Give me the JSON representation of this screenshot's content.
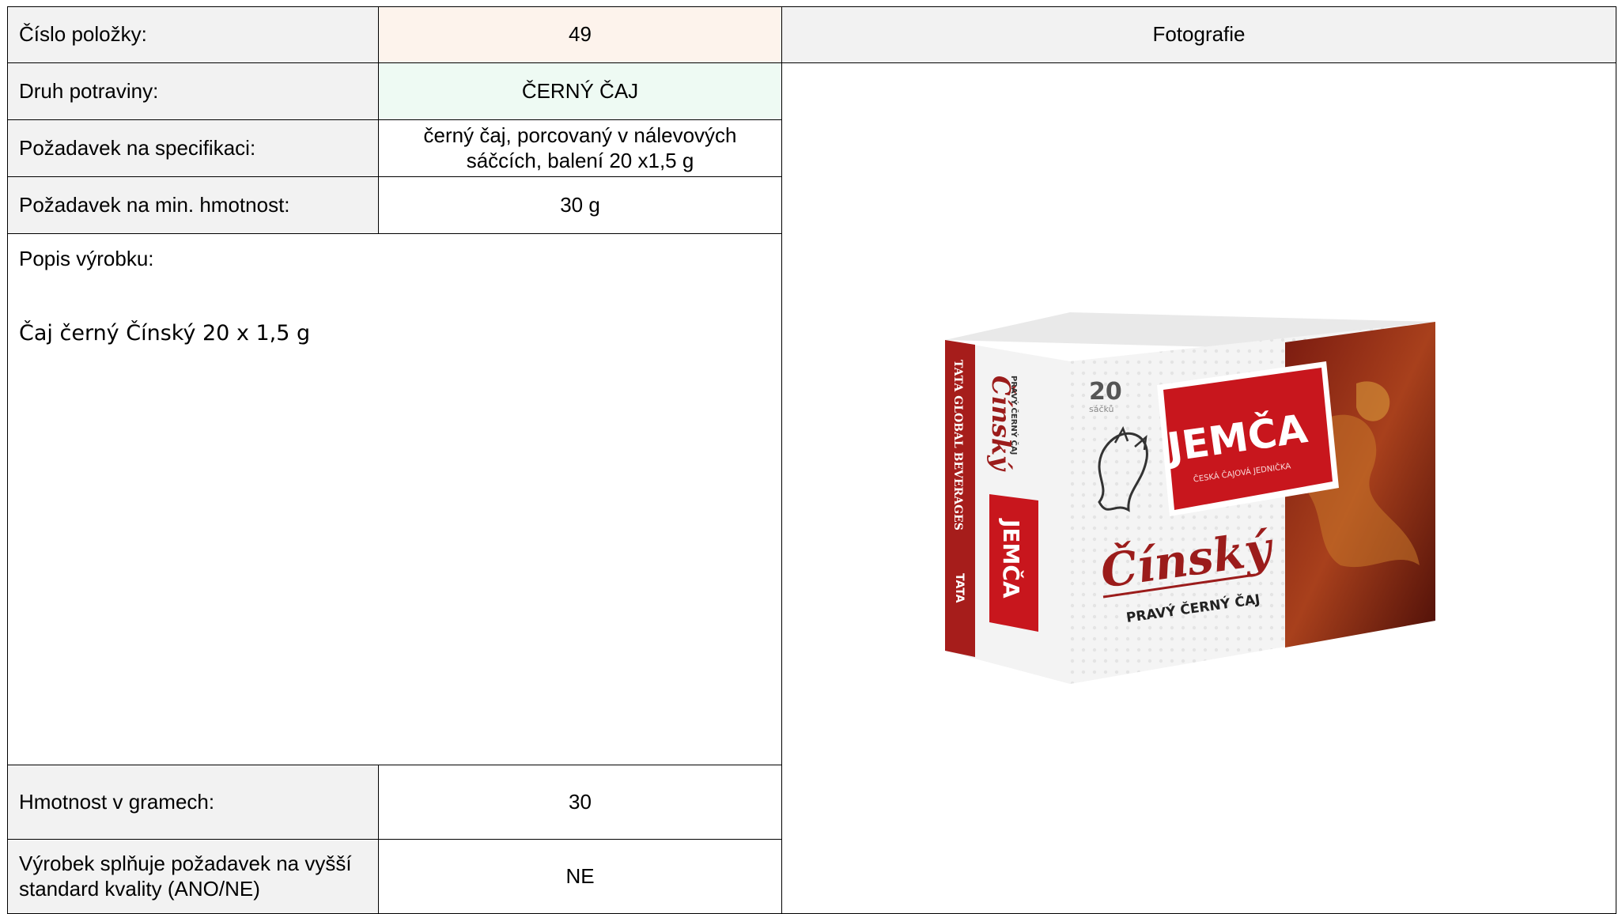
{
  "rows": {
    "item_no": {
      "label": "Číslo položky:",
      "value": "49"
    },
    "food_type": {
      "label": "Druh potraviny:",
      "value": "ČERNÝ ČAJ"
    },
    "spec": {
      "label": "Požadavek na specifikaci:",
      "value_line1": "černý čaj, porcovaný v nálevových",
      "value_line2": "sáčcích, balení 20 x1,5 g"
    },
    "min_weight": {
      "label": "Požadavek na min. hmotnost:",
      "value": "30 g"
    },
    "weight": {
      "label": "Hmotnost v gramech:",
      "value": "30"
    },
    "quality": {
      "label_line1": "Výrobek splňuje požadavek na vyšší",
      "label_line2": "standard kvality (ANO/NE)",
      "value": "NE"
    }
  },
  "description": {
    "title": "Popis výrobku:",
    "text": "Čaj černý Čínský 20 x 1,5 g"
  },
  "photo": {
    "header": "Fotografie",
    "product": {
      "brand": "JEMČA",
      "brand_tagline": "ČESKÁ ČAJOVÁ JEDNIČKA",
      "name": "Čínský",
      "subtitle": "PRAVÝ ČERNÝ ČAJ",
      "count": "20",
      "count_unit": "sáčků",
      "side_name": "Čínský",
      "side_subtitle": "PRAVÝ ČERNÝ ČAJ",
      "side_brand": "JEMČA",
      "side_company": "TATA GLOBAL BEVERAGES",
      "side_logo": "TATA"
    }
  },
  "colors": {
    "label_bg": "#f2f2f2",
    "item_no_bg": "#fdf3ec",
    "food_type_bg": "#eefaf3",
    "brand_red": "#c8161d",
    "dark_red": "#7a1a10"
  }
}
